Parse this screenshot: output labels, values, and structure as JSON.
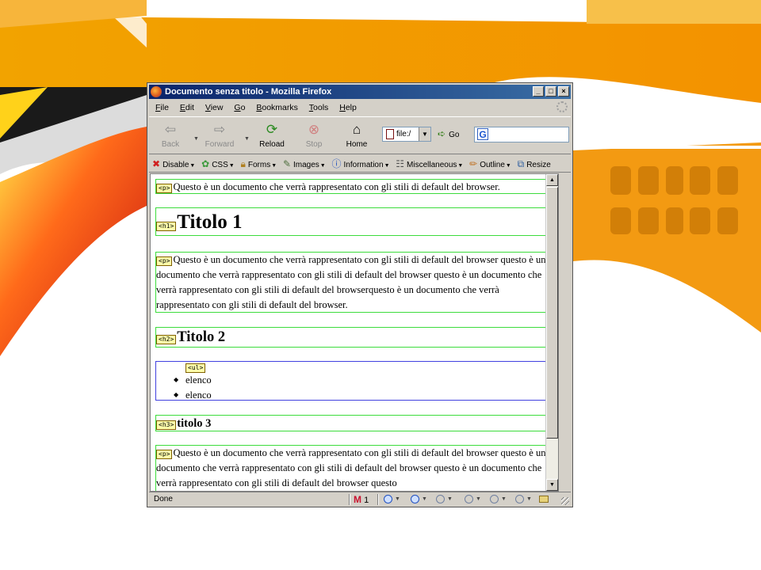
{
  "window": {
    "title": "Documento senza titolo - Mozilla Firefox",
    "min_label": "_",
    "max_label": "□",
    "close_label": "×"
  },
  "menu": [
    "File",
    "Edit",
    "View",
    "Go",
    "Bookmarks",
    "Tools",
    "Help"
  ],
  "nav": {
    "back": "Back",
    "forward": "Forward",
    "reload": "Reload",
    "stop": "Stop",
    "home": "Home",
    "url": "file:/",
    "go": "Go",
    "search_logo": "G"
  },
  "devbar": [
    "Disable",
    "CSS",
    "Forms",
    "Images",
    "Information",
    "Miscellaneous",
    "Outline",
    "Resize"
  ],
  "content": {
    "p1": "Questo è un documento che verrà rappresentato con gli stili di default del browser.",
    "h1": "Titolo 1",
    "p2": "Questo è un documento che verrà rappresentato con gli stili di default del browser questo è un documento che verrà rappresentato con gli stili di default del browser questo è un documento che verrà rappresentato con gli stili di default del browserquesto è un documento che verrà rappresentato con gli stili di default del browser.",
    "h2": "Titolo 2",
    "list": [
      "elenco",
      "elenco"
    ],
    "h3": "titolo 3",
    "p3": "Questo è un documento che verrà rappresentato con gli stili di default del browser questo è un documento che verrà rappresentato con gli stili di default del browser questo è un documento che verrà rappresentato con gli stili di default del browser questo",
    "tags": {
      "p": "<p>",
      "h1": "<h1>",
      "h2": "<h2>",
      "h3": "<h3>",
      "ul": "<ul>"
    }
  },
  "status": {
    "text": "Done",
    "gmail_count": "1",
    "gmail_logo": "M"
  },
  "colors": {
    "outline_green": "#3cdc3c",
    "outline_blue": "#4040e0",
    "tag_bg": "#ffffaa",
    "slide_orange": "#f49a00"
  }
}
